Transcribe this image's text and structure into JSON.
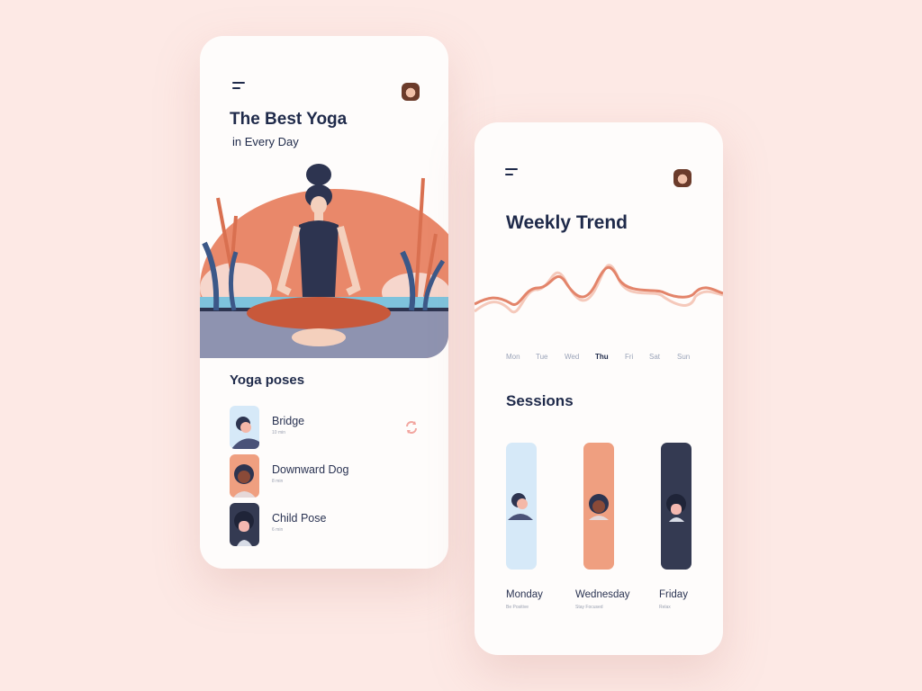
{
  "screen1": {
    "title": "The Best Yoga",
    "subtitle": "in Every Day",
    "section_title": "Yoga poses",
    "poses": [
      {
        "name": "Bridge",
        "duration": "10 min",
        "thumb_color": "#d6e9f8"
      },
      {
        "name": "Downward Dog",
        "duration": "8 min",
        "thumb_color": "#ef9f80"
      },
      {
        "name": "Child Pose",
        "duration": "6 min",
        "thumb_color": "#343a52"
      }
    ],
    "refresh_icon": "refresh-icon"
  },
  "screen2": {
    "title": "Weekly Trend",
    "days": [
      "Mon",
      "Tue",
      "Wed",
      "Thu",
      "Fri",
      "Sat",
      "Sun"
    ],
    "active_day": "Thu",
    "sessions_title": "Sessions",
    "sessions": [
      {
        "day": "Monday",
        "tag": "Be Positive",
        "color": "#d6e9f8"
      },
      {
        "day": "Wednesday",
        "tag": "Stay Focused",
        "color": "#ef9f80"
      },
      {
        "day": "Friday",
        "tag": "Relax",
        "color": "#343a52"
      }
    ]
  },
  "colors": {
    "accent": "#e9805e",
    "navy": "#1f2a4a",
    "background": "#fde9e5"
  }
}
